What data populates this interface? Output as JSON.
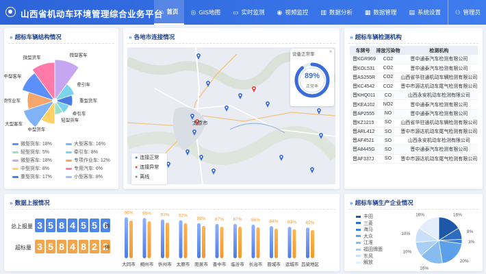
{
  "app": {
    "title": "山西省机动车环境管理综合业务平台",
    "user": "管理员"
  },
  "nav": [
    {
      "label": "首页",
      "icon": "home-icon",
      "glyph": "⌂",
      "active": true
    },
    {
      "label": "GIS地图",
      "icon": "map-icon",
      "glyph": "◎"
    },
    {
      "label": "实时监测",
      "icon": "monitor-icon",
      "glyph": "▭"
    },
    {
      "label": "视频监控",
      "icon": "camera-icon",
      "glyph": "◉"
    },
    {
      "label": "数据分析",
      "icon": "chart-icon",
      "glyph": "▥"
    },
    {
      "label": "数据管理",
      "icon": "database-icon",
      "glyph": "▦"
    },
    {
      "label": "系统设置",
      "icon": "settings-icon",
      "glyph": "▤"
    }
  ],
  "panels": {
    "vehicle_structure": "超标车辆结构情况",
    "map": "各地市连接情况",
    "inspection": "超标车辆检测机构",
    "report": "数据上报情况",
    "manufacturer": "超标车辆生产企业情况"
  },
  "rose": {
    "labels": [
      "微型客车",
      "牵引车",
      "重型货车",
      "牵引车",
      "轻型货车",
      "中型货车",
      "大型客车",
      "专项作业车",
      "中型客车",
      "微型货车"
    ],
    "legend": [
      {
        "name": "微型货车",
        "value": "18%",
        "color": "#5b8ff9"
      },
      {
        "name": "大型客车",
        "value": "16%",
        "color": "#7fb3f5"
      },
      {
        "name": "轻型货车",
        "value": "5%",
        "color": "#98e0c8"
      },
      {
        "name": "牵引车",
        "value": "8%",
        "color": "#7cd3ec"
      },
      {
        "name": "微型客车",
        "value": "18%",
        "color": "#c6a6f0"
      },
      {
        "name": "专项作业车",
        "value": "12%",
        "color": "#f5a76b"
      },
      {
        "name": "中型货车",
        "value": "8%",
        "color": "#ffd166"
      },
      {
        "name": "专用汽车",
        "value": "6%",
        "color": "#ff7aa8"
      },
      {
        "name": "重型货车",
        "value": "17%",
        "color": "#4b7be5"
      },
      {
        "name": "小型客车",
        "value": "8%",
        "color": "#96c3ff"
      }
    ]
  },
  "map": {
    "city_label": "太原市",
    "legend": [
      {
        "label": "连接正常",
        "color": "#3b6cd8"
      },
      {
        "label": "连接异常",
        "color": "#e04646"
      },
      {
        "label": "离线",
        "color": "#888888"
      }
    ],
    "gauge": {
      "title": "设备正常率",
      "value": "89%",
      "sub": "正常率",
      "pct": 89
    }
  },
  "inspection": {
    "headers": [
      "车牌号",
      "排放污染物",
      "检测机构"
    ],
    "rows": [
      [
        "晋KGR969",
        "CO2",
        "晋中通泰汽车检测有限公司"
      ],
      [
        "晋KOL531",
        "CO2",
        "晋中通泰汽车检测有限公司"
      ],
      [
        "晋AS255R",
        "CO2",
        "山西省华驻通机动车辆检测有限公司"
      ],
      [
        "晋KC4542",
        "CO2",
        "晋中市源达机动车尾气检测有限公司"
      ],
      [
        "晋KHQ011",
        "CO",
        "山西永安机动车检测有限公司"
      ],
      [
        "晋KEA102",
        "NO2",
        "晋中通泰汽车检测有限公司"
      ],
      [
        "晋AP2555",
        "NO",
        "晋中通泰汽车检测有限公司"
      ],
      [
        "晋KZ1215",
        "SO",
        "山西省华驻通机动车辆检测有限公司"
      ],
      [
        "晋ARL412",
        "SO",
        "晋中市源达机动车尾气检测有限公司"
      ],
      [
        "晋AF4521",
        "SO",
        "山西永安机动车检测有限公司"
      ],
      [
        "晋A8445G",
        "SO",
        "晋中通泰汽车检测有限公司"
      ],
      [
        "晋AF337J",
        "SO",
        "晋中市源达机动车尾气检测有限公司"
      ]
    ]
  },
  "report": {
    "total_label": "总上报量",
    "total_digits": [
      "3",
      "5",
      "8",
      "4",
      "5",
      "5",
      "6"
    ],
    "over_label": "超标量",
    "over_digits": [
      "3",
      "5",
      "8",
      "4",
      "8",
      "2",
      "2"
    ],
    "unit": "件"
  },
  "chart_data": [
    {
      "type": "bar",
      "title": "",
      "categories": [
        "大同市",
        "朔州市",
        "忻州市",
        "太原市",
        "阳泉市",
        "晋中市",
        "临汾市",
        "长治市",
        "晋城市",
        "运城市",
        "吕梁地区"
      ],
      "values": [
        96,
        95,
        93,
        92,
        88,
        87,
        87,
        86,
        84,
        83,
        82
      ],
      "unit": "%",
      "ylim": [
        0,
        100
      ]
    },
    {
      "type": "pie",
      "categories": [
        "丰田",
        "三菱",
        "海马",
        "大众",
        "江淮",
        "福田牌面",
        "东风",
        "解放"
      ],
      "values": [
        16,
        8,
        3,
        20,
        16,
        10,
        10,
        16
      ],
      "colors": [
        "#1e56a8",
        "#2d6cc0",
        "#3b82d8",
        "#5ba0e8",
        "#86bcef",
        "#a9cff4",
        "#c9e0f8",
        "#e4eefa"
      ]
    }
  ]
}
